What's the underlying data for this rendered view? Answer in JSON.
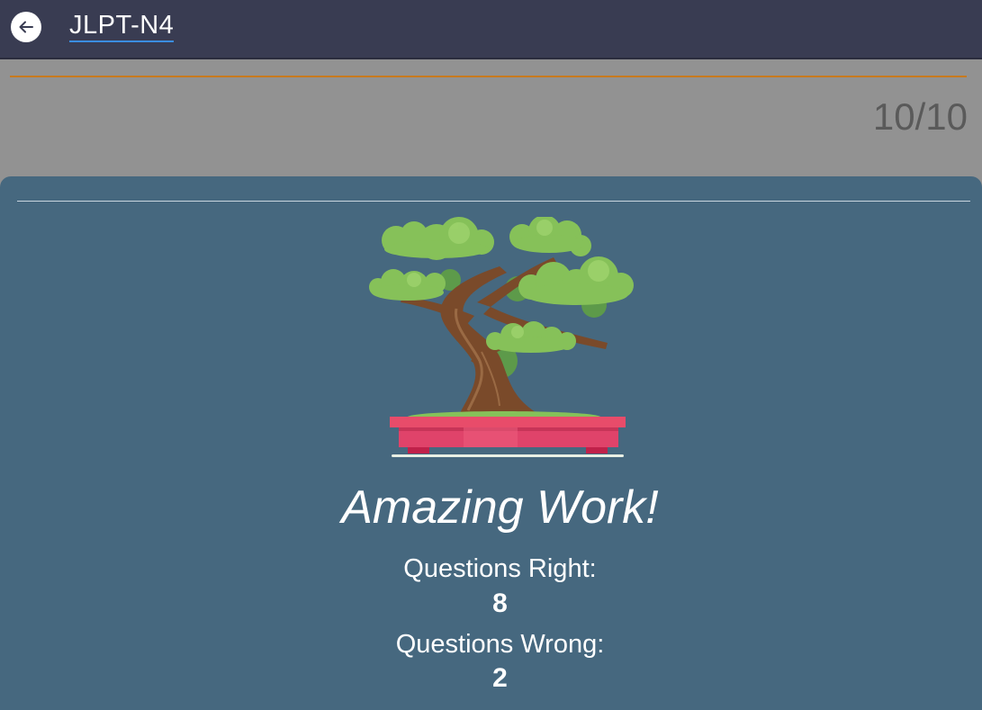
{
  "header": {
    "title": "JLPT-N4",
    "back_icon": "arrow-left-icon"
  },
  "quiz": {
    "progress_text": "10/10",
    "progress_fraction": 1.0,
    "progress_color": "#c87a1e"
  },
  "results": {
    "headline": "Amazing Work!",
    "illustration": "bonsai-tree-illustration",
    "right_label": "Questions Right:",
    "right_value": "8",
    "wrong_label": "Questions Wrong:",
    "wrong_value": "2"
  },
  "colors": {
    "header_bg": "#393c52",
    "panel_bg": "#46687f",
    "page_bg": "#929292"
  }
}
